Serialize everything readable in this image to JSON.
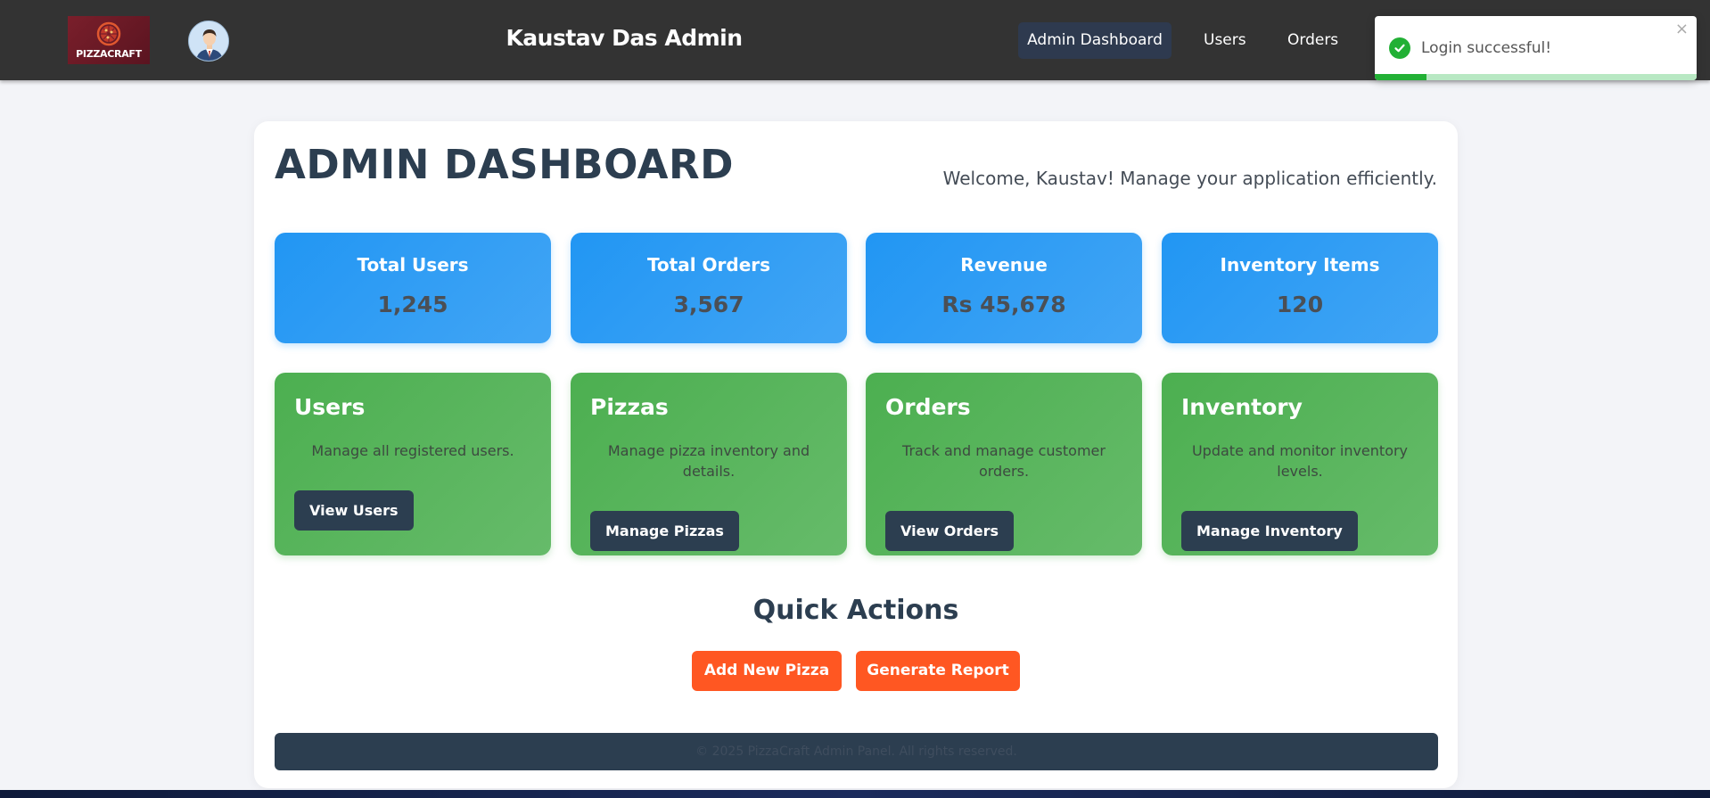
{
  "navbar": {
    "logo_text": "PIZZACRAFT",
    "title": "Kaustav Das Admin",
    "links": [
      {
        "label": "Admin Dashboard",
        "active": true
      },
      {
        "label": "Users",
        "active": false
      },
      {
        "label": "Orders",
        "active": false
      }
    ]
  },
  "toast": {
    "message": "Login successful!",
    "close_symbol": "×",
    "icon": "check-circle-icon",
    "progress_fraction": 0.16,
    "color": "#22b035"
  },
  "dashboard": {
    "title": "ADMIN DASHBOARD",
    "welcome": "Welcome, Kaustav! Manage your application efficiently."
  },
  "stats": [
    {
      "label": "Total Users",
      "value": "1,245"
    },
    {
      "label": "Total Orders",
      "value": "3,567"
    },
    {
      "label": "Revenue",
      "value": "Rs 45,678"
    },
    {
      "label": "Inventory Items",
      "value": "120"
    }
  ],
  "management": [
    {
      "title": "Users",
      "description": "Manage all registered users.",
      "button": "View Users"
    },
    {
      "title": "Pizzas",
      "description": "Manage pizza inventory and details.",
      "button": "Manage Pizzas"
    },
    {
      "title": "Orders",
      "description": "Track and manage customer orders.",
      "button": "View Orders"
    },
    {
      "title": "Inventory",
      "description": "Update and monitor inventory levels.",
      "button": "Manage Inventory"
    }
  ],
  "quick_actions": {
    "title": "Quick Actions",
    "buttons": [
      "Add New Pizza",
      "Generate Report"
    ]
  },
  "footer": {
    "text": "© 2025 PizzaCraft Admin Panel. All rights reserved."
  },
  "colors": {
    "navbar": "#333333",
    "stat_card": "#2196f3",
    "management_card": "#4caf50",
    "dark_button": "#2c3e50",
    "action_button": "#ff5722"
  }
}
